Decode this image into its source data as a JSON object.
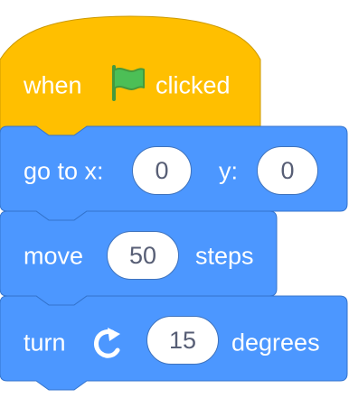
{
  "colors": {
    "events_fill": "#ffbf00",
    "events_stroke": "#cc9900",
    "motion_fill": "#4c97ff",
    "motion_stroke": "#3373cc",
    "flag_green": "#4cbf56",
    "text_white": "#ffffff",
    "input_text": "#575e75"
  },
  "script": {
    "hat_block": {
      "word_when": "when",
      "icon": "green-flag-icon",
      "word_clicked": "clicked"
    },
    "goto_block": {
      "label_go_to_x": "go to x:",
      "x_value": "0",
      "label_y": "y:",
      "y_value": "0"
    },
    "move_block": {
      "label_move": "move",
      "steps_value": "50",
      "label_steps": "steps"
    },
    "turn_block": {
      "label_turn": "turn",
      "icon": "rotate-clockwise-icon",
      "degrees_value": "15",
      "label_degrees": "degrees"
    }
  }
}
